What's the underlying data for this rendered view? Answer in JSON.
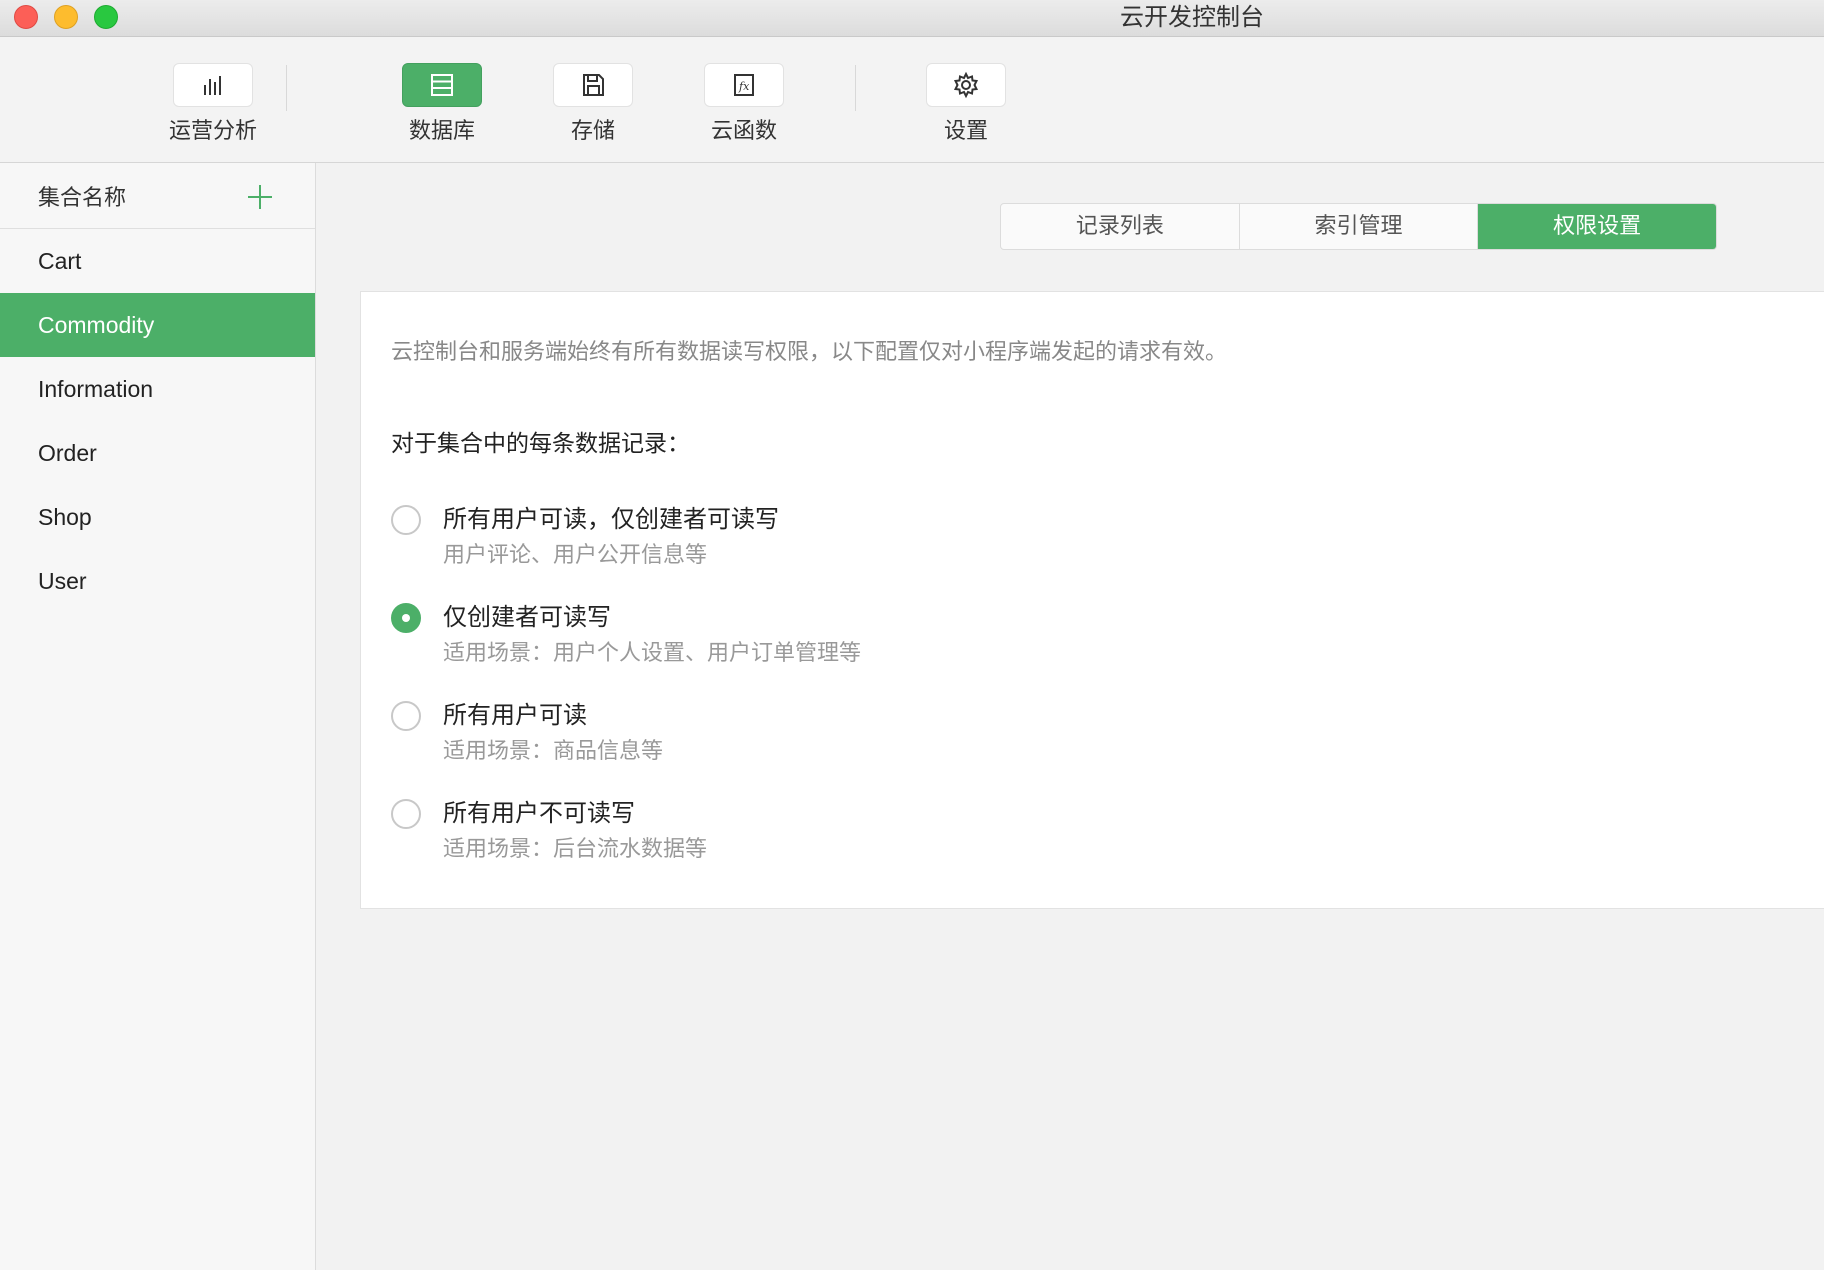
{
  "window": {
    "title": "云开发控制台"
  },
  "toolbar": {
    "items": [
      {
        "label": "运营分析",
        "icon": "bar-chart-icon"
      },
      {
        "label": "数据库",
        "icon": "database-icon"
      },
      {
        "label": "存储",
        "icon": "storage-icon"
      },
      {
        "label": "云函数",
        "icon": "cloud-function-icon"
      },
      {
        "label": "设置",
        "icon": "gear-icon"
      }
    ],
    "active": "数据库"
  },
  "sidebar": {
    "title": "集合名称",
    "add_icon": "plus-icon",
    "collections": [
      "Cart",
      "Commodity",
      "Information",
      "Order",
      "Shop",
      "User"
    ],
    "selected": "Commodity"
  },
  "tabs": {
    "items": [
      "记录列表",
      "索引管理",
      "权限设置"
    ],
    "active": "权限设置"
  },
  "permissions": {
    "notice": "云控制台和服务端始终有所有数据读写权限，以下配置仅对小程序端发起的请求有效。",
    "question": "对于集合中的每条数据记录：",
    "options": [
      {
        "label": "所有用户可读，仅创建者可读写",
        "desc": "用户评论、用户公开信息等"
      },
      {
        "label": "仅创建者可读写",
        "desc": "适用场景：用户个人设置、用户订单管理等"
      },
      {
        "label": "所有用户可读",
        "desc": "适用场景：商品信息等"
      },
      {
        "label": "所有用户不可读写",
        "desc": "适用场景：后台流水数据等"
      }
    ],
    "selected": "仅创建者可读写"
  },
  "colors": {
    "accent": "#4caf68"
  }
}
